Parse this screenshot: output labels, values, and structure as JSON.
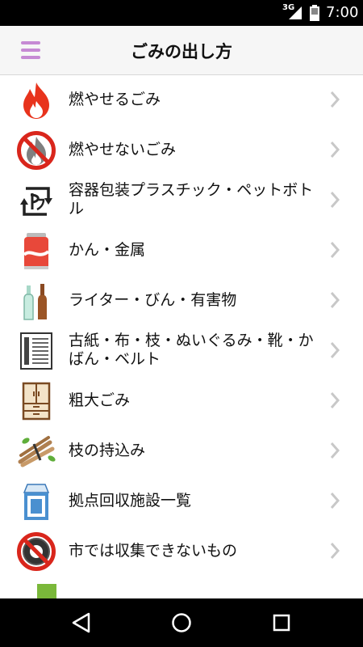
{
  "status_bar": {
    "network": "3G",
    "time": "7:00"
  },
  "app_bar": {
    "title": "ごみの出し方",
    "menu_icon": "hamburger-menu-icon"
  },
  "list": {
    "items": [
      {
        "label": "燃やせるごみ",
        "icon": "burnable-flame-icon"
      },
      {
        "label": "燃やせないごみ",
        "icon": "non-burnable-prohibited-flame-icon"
      },
      {
        "label": "容器包装プラスチック・ペットボトル",
        "icon": "plastic-recycle-mark-icon"
      },
      {
        "label": "かん・金属",
        "icon": "soda-can-icon"
      },
      {
        "label": "ライター・びん・有害物",
        "icon": "bottles-icon"
      },
      {
        "label": "古紙・布・枝・ぬいぐるみ・靴・かばん・ベルト",
        "icon": "newspaper-bundle-icon"
      },
      {
        "label": "粗大ごみ",
        "icon": "cabinet-icon"
      },
      {
        "label": "枝の持込み",
        "icon": "branches-bundle-icon"
      },
      {
        "label": "拠点回収施設一覧",
        "icon": "milk-carton-icon"
      },
      {
        "label": "市では収集できないもの",
        "icon": "prohibited-tire-icon"
      },
      {
        "label": "",
        "icon": "green-item-icon"
      }
    ]
  },
  "nav_bar": {
    "back_icon": "back-triangle-icon",
    "home_icon": "home-circle-icon",
    "recents_icon": "recents-square-icon"
  },
  "colors": {
    "accent": "#c68ad4",
    "flame": "#e8331c",
    "prohibit": "#d9261c",
    "chevron": "#c8c8c8"
  }
}
